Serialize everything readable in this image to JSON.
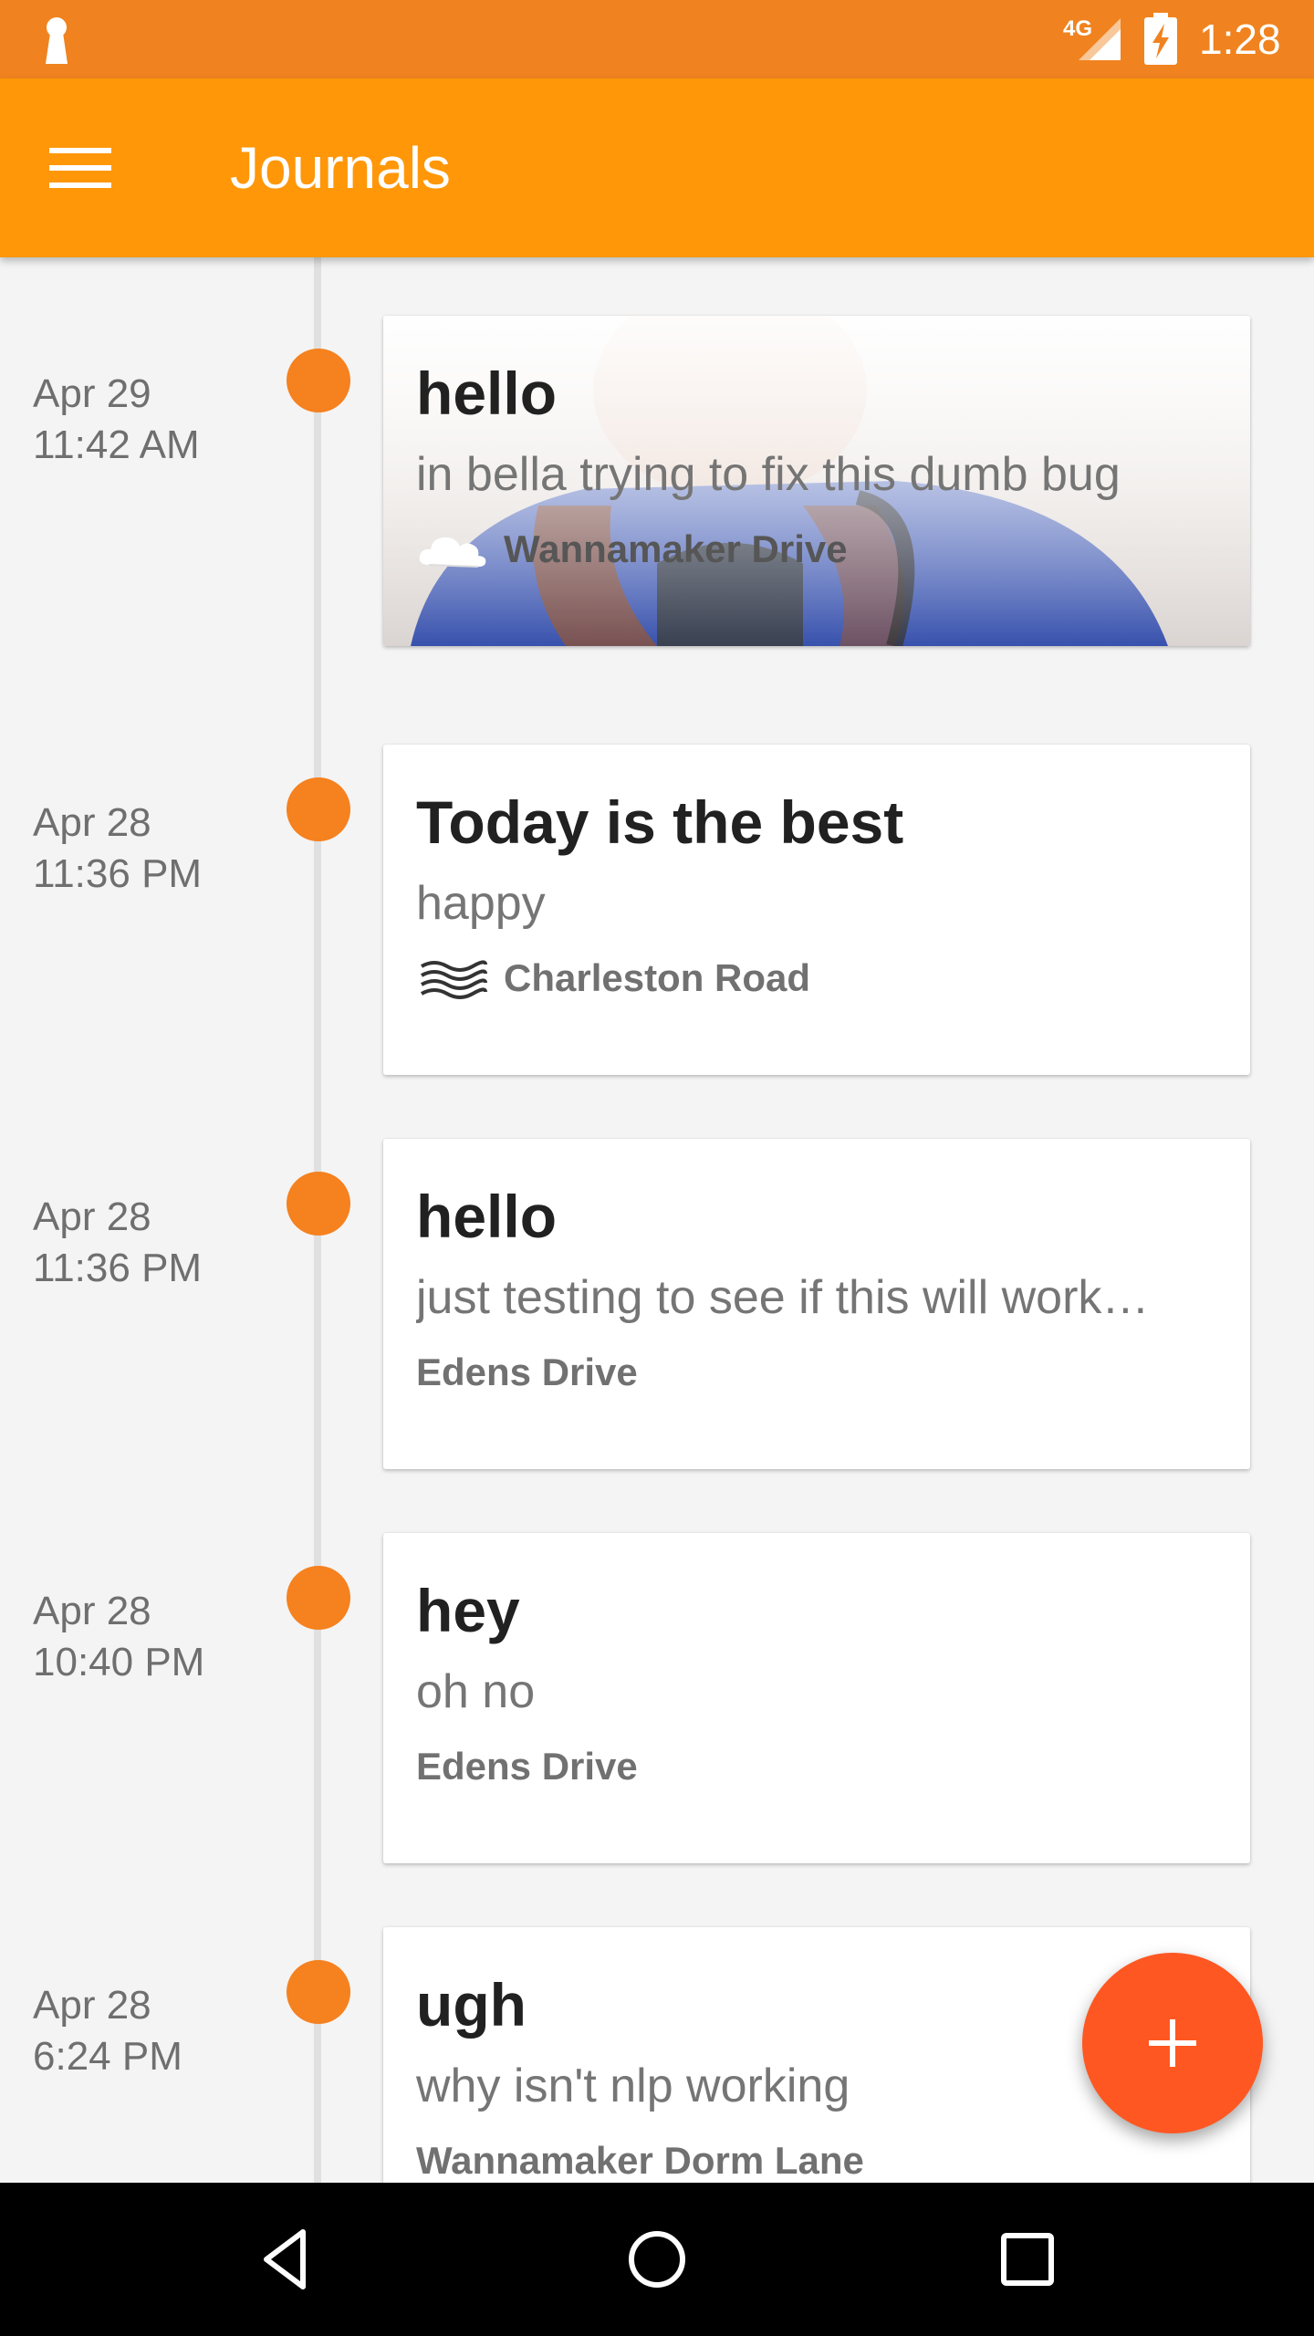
{
  "status_bar": {
    "network": "4G",
    "time": "1:28"
  },
  "app_bar": {
    "title": "Journals",
    "menu_icon": "hamburger-menu-icon"
  },
  "colors": {
    "status_bar": "#f0831f",
    "app_bar": "#ff9708",
    "timeline_dot": "#f5811f",
    "fab": "#ff5722"
  },
  "entries": [
    {
      "date": "Apr 29",
      "time": "11:42 AM",
      "title": "hello",
      "body": "in bella trying to fix this dumb bug",
      "location": "Wannamaker Drive",
      "weather_icon": "cloud-icon",
      "has_photo": true
    },
    {
      "date": "Apr 28",
      "time": "11:36 PM",
      "title": "Today is the best",
      "body": "happy",
      "location": "Charleston Road",
      "weather_icon": "fog-icon",
      "has_photo": false
    },
    {
      "date": "Apr 28",
      "time": "11:36 PM",
      "title": "hello",
      "body": "just testing to see if this will work…",
      "location": "Edens Drive",
      "weather_icon": null,
      "has_photo": false
    },
    {
      "date": "Apr 28",
      "time": "10:40 PM",
      "title": "hey",
      "body": "oh no",
      "location": "Edens Drive",
      "weather_icon": null,
      "has_photo": false
    },
    {
      "date": "Apr 28",
      "time": "6:24 PM",
      "title": "ugh",
      "body": "why isn't nlp working",
      "location": "Wannamaker Dorm Lane",
      "weather_icon": null,
      "has_photo": false
    }
  ],
  "fab": {
    "icon": "plus-icon"
  },
  "nav_bar": {
    "back_icon": "back-triangle-icon",
    "home_icon": "home-circle-icon",
    "recents_icon": "recents-square-icon"
  }
}
